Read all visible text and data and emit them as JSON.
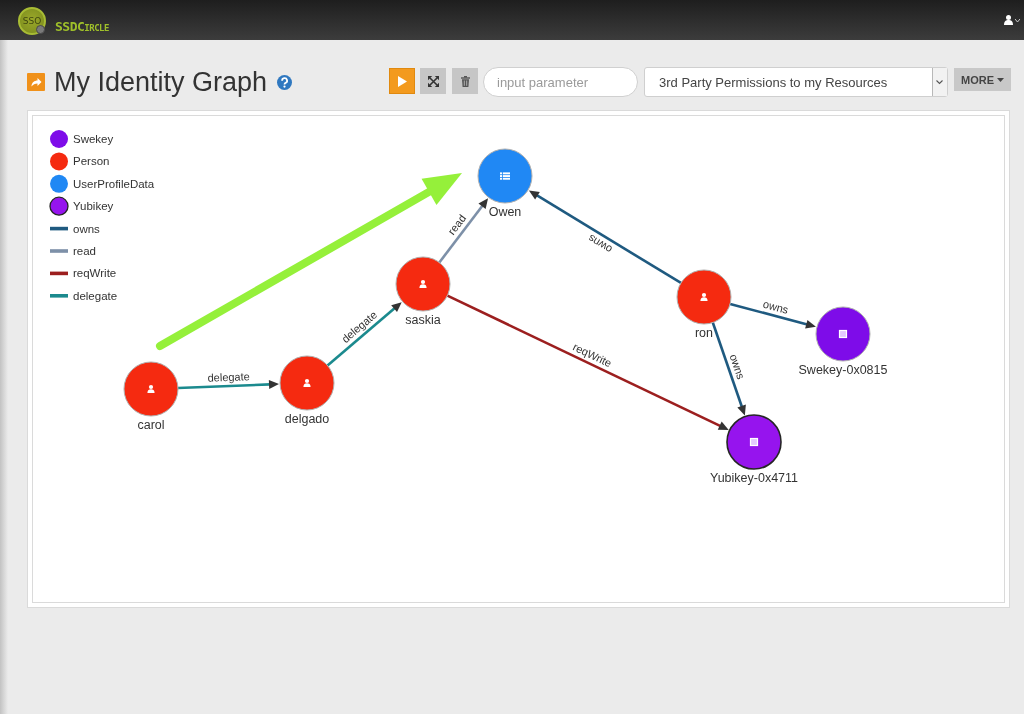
{
  "top_bar": {
    "logo_text": "SSO",
    "brand": "SSDCircle"
  },
  "header": {
    "title": "My Identity Graph"
  },
  "toolbar": {
    "parameter_input": {
      "placeholder": "input parameter"
    },
    "query_select": {
      "value": "3rd Party Permissions to my Resources"
    },
    "more_button": "MORE"
  },
  "graph": {
    "legend": [
      {
        "label": "Swekey",
        "kind": "node",
        "color": "#7e0ce9",
        "outlined": false
      },
      {
        "label": "Person",
        "kind": "node",
        "color": "#f52a10",
        "outlined": false
      },
      {
        "label": "UserProfileData",
        "kind": "node",
        "color": "#2088f4",
        "outlined": false
      },
      {
        "label": "Yubikey",
        "kind": "node",
        "color": "#9614ee",
        "outlined": true
      },
      {
        "label": "owns",
        "kind": "edge",
        "color": "#1f5a80"
      },
      {
        "label": "read",
        "kind": "edge",
        "color": "#7d90a8"
      },
      {
        "label": "reqWrite",
        "kind": "edge",
        "color": "#9c1f1f"
      },
      {
        "label": "delegate",
        "kind": "edge",
        "color": "#1b8a8e"
      }
    ],
    "nodes": [
      {
        "label": "Owen",
        "kind": "profile",
        "color": "#2088f4",
        "outlined": false
      },
      {
        "label": "saskia",
        "kind": "person",
        "color": "#f52a10",
        "outlined": false
      },
      {
        "label": "ron",
        "kind": "person",
        "color": "#f52a10",
        "outlined": false
      },
      {
        "label": "Swekey-0x0815",
        "kind": "device",
        "color": "#7e0ce9",
        "outlined": false
      },
      {
        "label": "carol",
        "kind": "person",
        "color": "#f52a10",
        "outlined": false
      },
      {
        "label": "delgado",
        "kind": "person",
        "color": "#f52a10",
        "outlined": false
      },
      {
        "label": "Yubikey-0x4711",
        "kind": "device",
        "color": "#9614ee",
        "outlined": true
      }
    ],
    "edges": [
      {
        "label": "delegate",
        "color": "#1b8a8e"
      },
      {
        "label": "delegate",
        "color": "#1b8a8e"
      },
      {
        "label": "read",
        "color": "#7d90a8"
      },
      {
        "label": "reqWrite",
        "color": "#9c1f1f"
      },
      {
        "label": "owns",
        "color": "#1f5a80"
      },
      {
        "label": "owns",
        "color": "#1f5a80"
      },
      {
        "label": "owns",
        "color": "#1f5a80"
      }
    ],
    "annotation_arrow": true
  }
}
